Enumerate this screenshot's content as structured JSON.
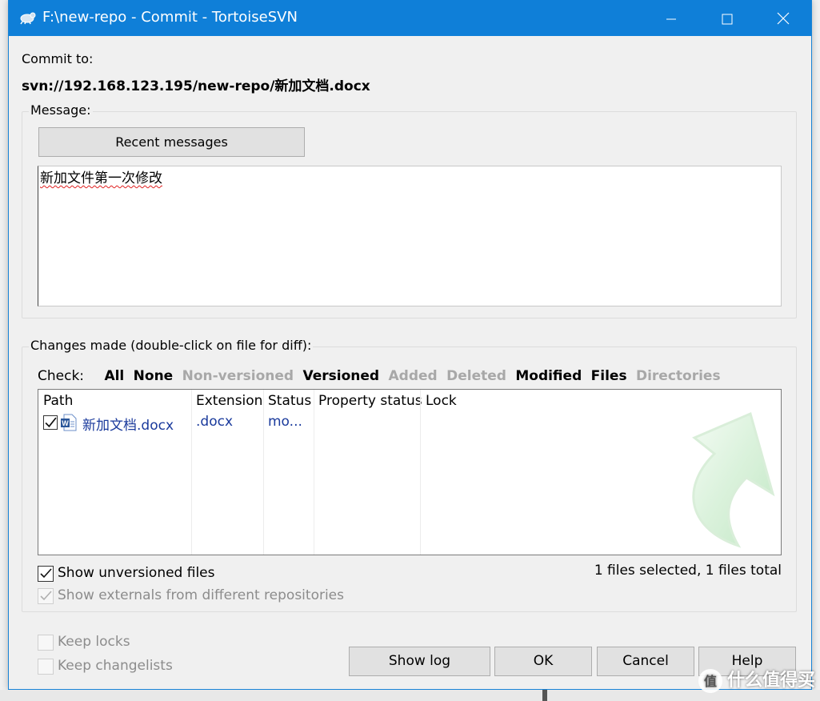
{
  "window": {
    "title": "F:\\new-repo - Commit - TortoiseSVN",
    "minimize": "—",
    "maximize": "☐",
    "close": "✕"
  },
  "commit": {
    "label": "Commit to:",
    "url": "svn://192.168.123.195/new-repo/新加文档.docx"
  },
  "message": {
    "group_label": "Message:",
    "recent_button": "Recent messages",
    "text": "新加文件第一次修改"
  },
  "changes": {
    "group_label": "Changes made (double-click on file for diff):",
    "check_label": "Check:",
    "filters": [
      {
        "label": "All",
        "enabled": true
      },
      {
        "label": "None",
        "enabled": true
      },
      {
        "label": "Non-versioned",
        "enabled": false
      },
      {
        "label": "Versioned",
        "enabled": true
      },
      {
        "label": "Added",
        "enabled": false
      },
      {
        "label": "Deleted",
        "enabled": false
      },
      {
        "label": "Modified",
        "enabled": true
      },
      {
        "label": "Files",
        "enabled": true
      },
      {
        "label": "Directories",
        "enabled": false
      }
    ],
    "columns": [
      "Path",
      "Extension",
      "Status",
      "Property status",
      "Lock"
    ],
    "rows": [
      {
        "path": "新加文档.docx",
        "extension": ".docx",
        "status": "mo...",
        "property_status": "",
        "lock": "",
        "checked": true
      }
    ],
    "show_unversioned": "Show unversioned files",
    "show_externals": "Show externals from different repositories",
    "summary": "1 files selected, 1 files total"
  },
  "options": {
    "keep_locks": "Keep locks",
    "keep_changelists": "Keep changelists"
  },
  "buttons": {
    "show_log": "Show log",
    "ok": "OK",
    "cancel": "Cancel",
    "help": "Help"
  },
  "watermark": "什么值得买",
  "colors": {
    "titlebar": "#0f7fd8",
    "link_blue": "#1a3a9c",
    "disabled_grey": "#a8a8a8"
  }
}
